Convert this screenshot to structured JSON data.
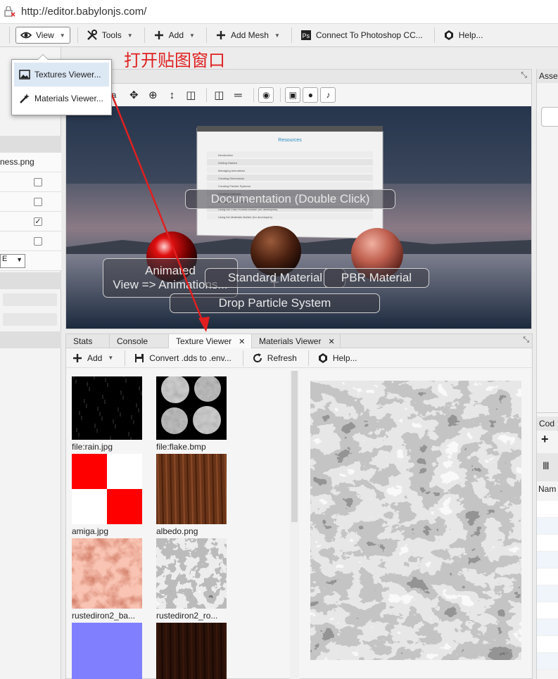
{
  "browser": {
    "url": "http://editor.babylonjs.com/"
  },
  "toolbar": {
    "view": "View",
    "tools": "Tools",
    "add": "Add",
    "add_mesh": "Add Mesh",
    "photoshop": "Connect To Photoshop CC...",
    "help": "Help..."
  },
  "view_menu": {
    "items": [
      "Textures Viewer...",
      "Materials Viewer..."
    ]
  },
  "annotation": "打开贴图窗口",
  "left_panel": {
    "file": "ness.png",
    "select_value": "E",
    "checkbox_states": [
      false,
      false,
      true,
      false
    ]
  },
  "viewport": {
    "camera_label": "era",
    "labels": {
      "documentation": "Documentation (Double Click)",
      "animated_1": "Animated",
      "animated_2": "View => Animations...",
      "standard": "Standard Material",
      "pbr": "PBR Material",
      "particles": "Drop Particle System"
    },
    "doc_sign": {
      "title": "Resources",
      "rows": [
        "Introduction",
        "Getting Started",
        "Managing Animations",
        "Creating Dimensions",
        "Creating Particle Systems",
        "Creating Materials",
        "Managing Mouvements",
        "Using the Post-Process Builder (for developers)",
        "Using the Materials Builder (for developers)"
      ]
    }
  },
  "bottom_panel": {
    "tabs": [
      "Stats",
      "Console",
      "Texture Viewer",
      "Materials Viewer"
    ],
    "tools": {
      "add": "Add",
      "convert": "Convert .dds to .env...",
      "refresh": "Refresh",
      "help": "Help..."
    },
    "textures": [
      {
        "name": "file:rain.jpg",
        "kind": "rain"
      },
      {
        "name": "file:flake.bmp",
        "kind": "flake"
      },
      {
        "name": "amiga.jpg",
        "kind": "amiga"
      },
      {
        "name": "albedo.png",
        "kind": "wood"
      },
      {
        "name": "rustediron2_ba...",
        "kind": "rust"
      },
      {
        "name": "rustediron2_ro...",
        "kind": "rough"
      },
      {
        "name": "",
        "kind": "normal"
      },
      {
        "name": "",
        "kind": "darkwood"
      }
    ]
  },
  "right_panel": {
    "assets_head": "Asse",
    "code_head": "Cod",
    "name_col": "Nam"
  }
}
